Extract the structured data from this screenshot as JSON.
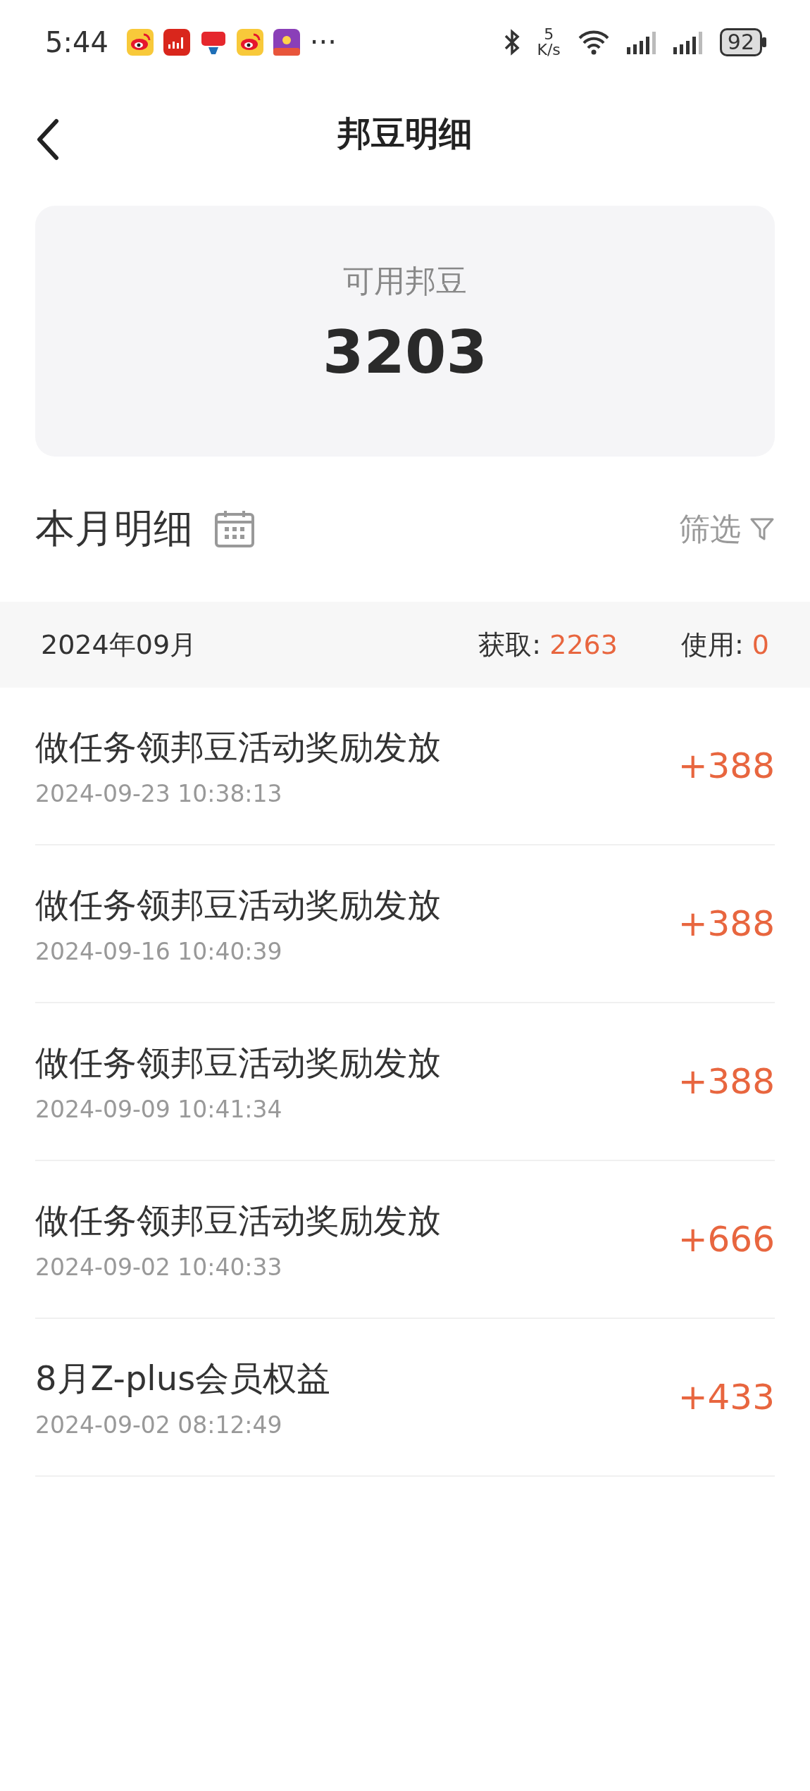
{
  "status_bar": {
    "time": "5:44",
    "more": "···",
    "speed_value": "5",
    "speed_unit": "K/s",
    "battery": "92"
  },
  "header": {
    "title": "邦豆明细"
  },
  "balance": {
    "label": "可用邦豆",
    "value": "3203"
  },
  "section": {
    "title": "本月明细",
    "filter": "筛选"
  },
  "month": {
    "label": "2024年09月",
    "earned_label": "获取:",
    "earned": "2263",
    "used_label": "使用:",
    "used": "0"
  },
  "records": [
    {
      "title": "做任务领邦豆活动奖励发放",
      "time": "2024-09-23 10:38:13",
      "amount": "+388"
    },
    {
      "title": "做任务领邦豆活动奖励发放",
      "time": "2024-09-16 10:40:39",
      "amount": "+388"
    },
    {
      "title": "做任务领邦豆活动奖励发放",
      "time": "2024-09-09 10:41:34",
      "amount": "+388"
    },
    {
      "title": "做任务领邦豆活动奖励发放",
      "time": "2024-09-02 10:40:33",
      "amount": "+666"
    },
    {
      "title": "8月Z-plus会员权益",
      "time": "2024-09-02 08:12:49",
      "amount": "+433"
    }
  ]
}
